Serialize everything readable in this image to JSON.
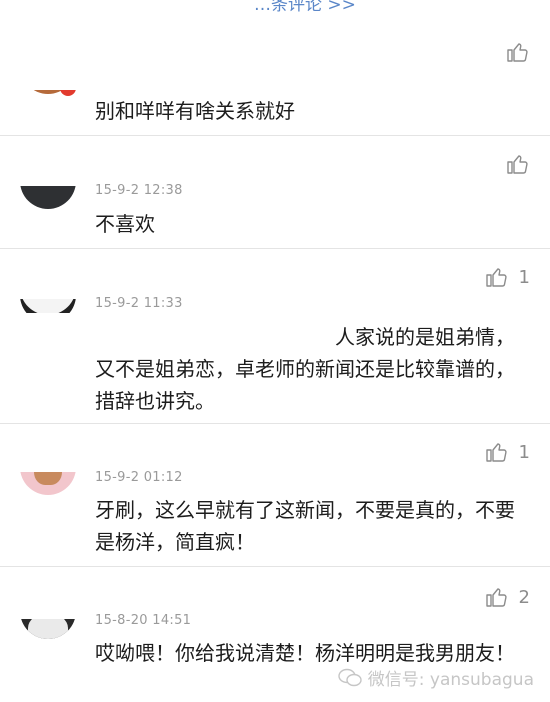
{
  "header": {
    "more_comments": "…条评论 >>"
  },
  "comments": [
    {
      "time": "",
      "text": "别和咩咩有啥关系就好",
      "likes": "",
      "avatar": "orange-portrait"
    },
    {
      "time": "15-9-2 12:38",
      "text": "不喜欢",
      "likes": "",
      "avatar": "dark-portrait"
    },
    {
      "time": "15-9-2 11:33",
      "text": "人家说的是姐弟情，又不是姐弟恋，卓老师的新闻还是比较靠谱的，措辞也讲究。",
      "likes": "1",
      "avatar": "white-portrait"
    },
    {
      "time": "15-9-2 01:12",
      "text": "牙刷，这么早就有了这新闻，不要是真的，不要是杨洋，简直疯！",
      "likes": "1",
      "avatar": "cat-portrait"
    },
    {
      "time": "15-8-20 14:51",
      "text": "哎呦喂！你给我说清楚！杨洋明明是我男朋友！",
      "likes": "2",
      "avatar": "person-portrait"
    }
  ],
  "watermark": {
    "text": "微信号: yansubagua",
    "icon": "wechat-icon"
  }
}
